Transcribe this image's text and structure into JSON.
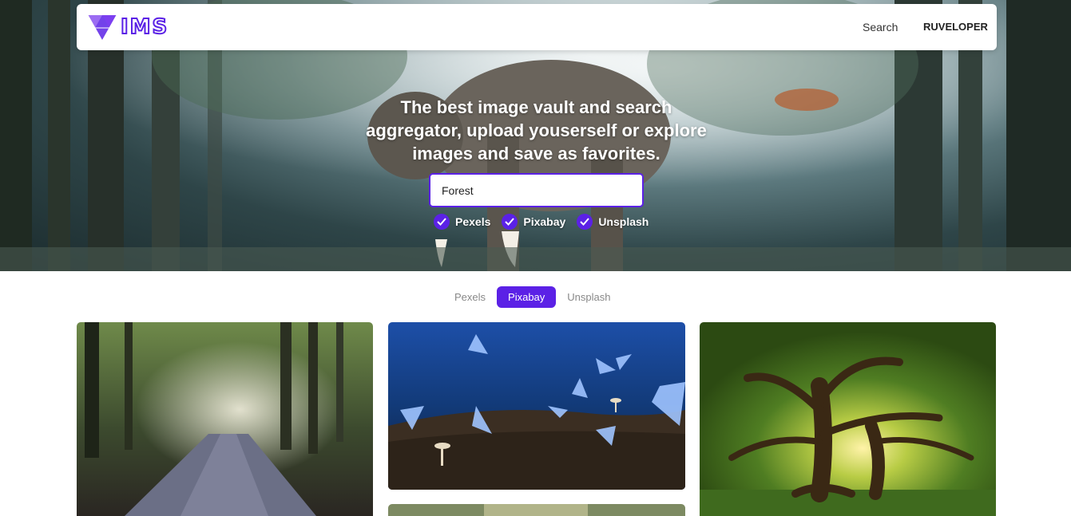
{
  "app": {
    "logo_text": "IMS"
  },
  "nav": {
    "search_label": "Search",
    "user_label": "RUVELOPER"
  },
  "hero": {
    "headline": "The best image vault and search aggregator, upload youserself or explore images and save as favorites.",
    "search_value": "Forest",
    "sources": [
      {
        "label": "Pexels",
        "checked": true
      },
      {
        "label": "Pixabay",
        "checked": true
      },
      {
        "label": "Unsplash",
        "checked": true
      }
    ]
  },
  "tabs": [
    {
      "label": "Pexels",
      "active": false
    },
    {
      "label": "Pixabay",
      "active": true
    },
    {
      "label": "Unsplash",
      "active": false
    }
  ],
  "colors": {
    "accent": "#5b21e6"
  },
  "gallery": {
    "images": [
      {
        "subject": "forest road with sunbeams"
      },
      {
        "subject": "blue butterflies and mushrooms"
      },
      {
        "subject": "large sunlit tree"
      },
      {
        "subject": "forest path (partially visible)"
      }
    ]
  }
}
